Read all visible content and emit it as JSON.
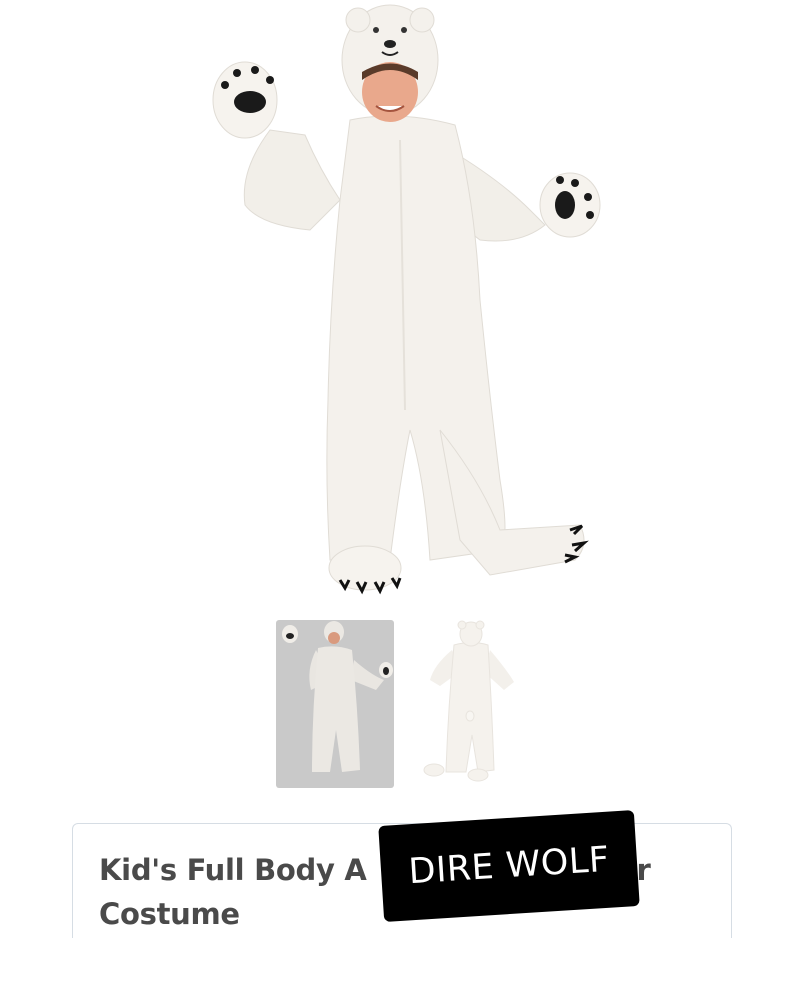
{
  "product": {
    "title": "Kid's Full Body Arctic Polar Bear Costume",
    "visible_title_line1": "Kid's Full Body A",
    "visible_title_line1_tail": "r",
    "visible_title_line2": "Costume"
  },
  "gallery": {
    "main_image": "polar-bear-costume-front",
    "thumbnails": [
      {
        "name": "front-view",
        "selected": true
      },
      {
        "name": "back-view",
        "selected": false
      }
    ]
  },
  "overlay": {
    "text": "DIRE WOLF",
    "background": "#000000",
    "color": "#ffffff"
  },
  "colors": {
    "title": "#4a4a4a",
    "card_border": "#d6dde4",
    "selected_thumb_bg": "#c9c9c9"
  }
}
